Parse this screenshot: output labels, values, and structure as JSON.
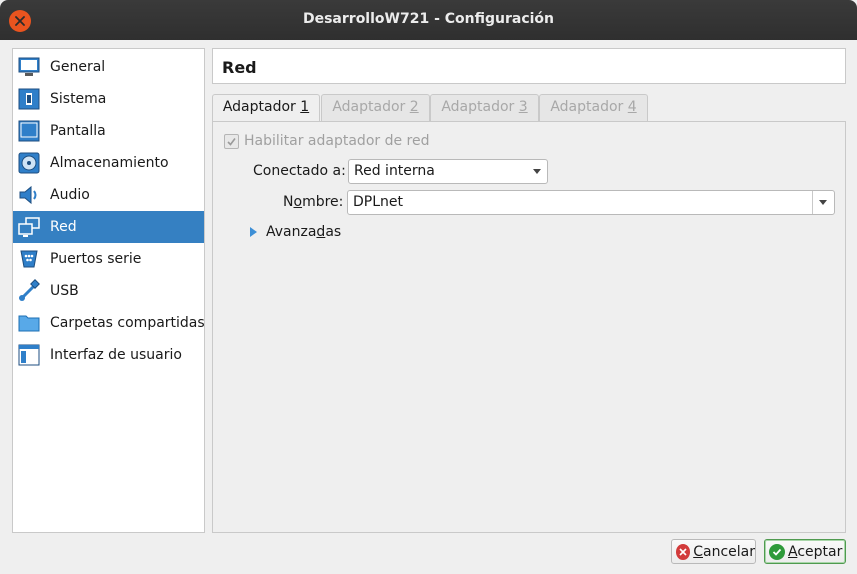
{
  "window": {
    "title": "DesarrolloW721 - Configuración"
  },
  "sidebar": {
    "items": [
      {
        "label": "General",
        "icon": "monitor-icon"
      },
      {
        "label": "Sistema",
        "icon": "chip-icon"
      },
      {
        "label": "Pantalla",
        "icon": "display-icon"
      },
      {
        "label": "Almacenamiento",
        "icon": "storage-disk-icon"
      },
      {
        "label": "Audio",
        "icon": "speaker-icon"
      },
      {
        "label": "Red",
        "icon": "network-icon",
        "selected": true
      },
      {
        "label": "Puertos serie",
        "icon": "serial-port-icon"
      },
      {
        "label": "USB",
        "icon": "usb-icon"
      },
      {
        "label": "Carpetas compartidas",
        "icon": "folder-icon"
      },
      {
        "label": "Interfaz de usuario",
        "icon": "window-ui-icon"
      }
    ]
  },
  "header": {
    "title": "Red"
  },
  "tabs": [
    {
      "label_pre": "Adaptador ",
      "label_key": "1",
      "active": true
    },
    {
      "label_pre": "Adaptador ",
      "label_key": "2",
      "active": false
    },
    {
      "label_pre": "Adaptador ",
      "label_key": "3",
      "active": false
    },
    {
      "label_pre": "Adaptador ",
      "label_key": "4",
      "active": false
    }
  ],
  "form": {
    "enable_adapter_label": "Habilitar adaptador de red",
    "enable_adapter_checked": true,
    "connected_label_pre": "Conectado a",
    "connected_label_post": ":",
    "connected_value": "Red interna",
    "name_label_pre": "N",
    "name_label_key": "o",
    "name_label_post": "mbre:",
    "name_value": "DPLnet",
    "advanced_label_pre": "Avanza",
    "advanced_label_key": "d",
    "advanced_label_post": "as"
  },
  "buttons": {
    "cancel_key": "C",
    "cancel_rest": "ancelar",
    "accept_key": "A",
    "accept_rest": "ceptar"
  },
  "colors": {
    "selection": "#3580c2",
    "titlebar": "#2f2f2f",
    "close": "#e9541f"
  }
}
